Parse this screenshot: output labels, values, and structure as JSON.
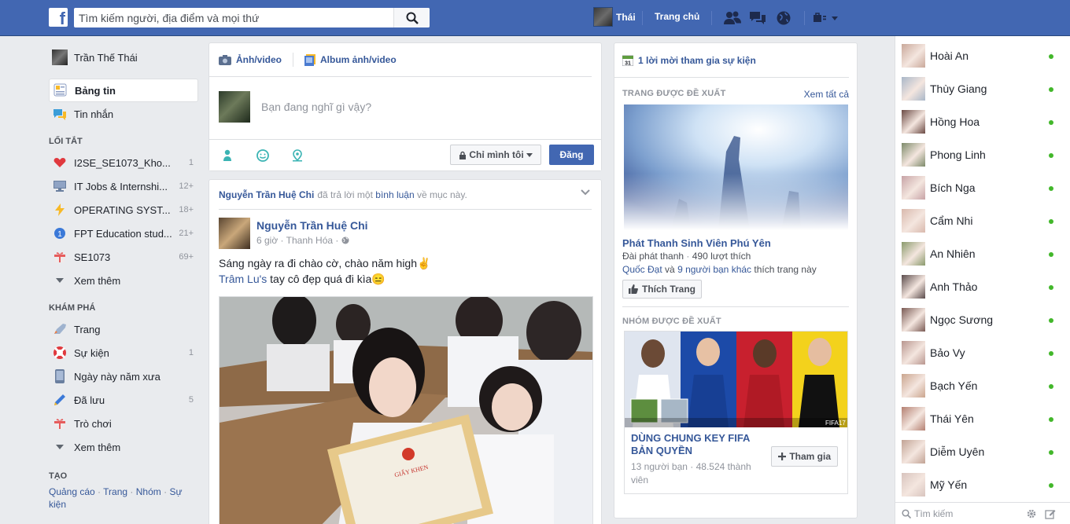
{
  "topbar": {
    "logo": "f",
    "search_placeholder": "Tìm kiếm người, địa điểm và mọi thứ",
    "profile_name": "Thái",
    "home_label": "Trang chủ"
  },
  "left": {
    "profile_name": "Trần Thế Thái",
    "nav": [
      {
        "label": "Bảng tin",
        "icon": "newsfeed-icon"
      },
      {
        "label": "Tin nhắn",
        "icon": "messages-icon"
      }
    ],
    "shortcuts_title": "LỐI TẮT",
    "shortcuts": [
      {
        "label": "I2SE_SE1073_Kho...",
        "count": "1",
        "icon": "heart-icon"
      },
      {
        "label": "IT Jobs & Internshi...",
        "count": "12+",
        "icon": "monitor-icon"
      },
      {
        "label": "OPERATING SYST...",
        "count": "18+",
        "icon": "lightning-icon"
      },
      {
        "label": "FPT Education stud...",
        "count": "21+",
        "icon": "badge-icon"
      },
      {
        "label": "SE1073",
        "count": "69+",
        "icon": "gift-icon"
      }
    ],
    "see_more_1": "Xem thêm",
    "explore_title": "KHÁM PHÁ",
    "explore": [
      {
        "label": "Trang",
        "count": "",
        "icon": "rocket-icon"
      },
      {
        "label": "Sự kiện",
        "count": "1",
        "icon": "lifebuoy-icon"
      },
      {
        "label": "Ngày này năm xưa",
        "count": "",
        "icon": "phone-icon"
      },
      {
        "label": "Đã lưu",
        "count": "5",
        "icon": "pencil-icon"
      },
      {
        "label": "Trò chơi",
        "count": "",
        "icon": "gift-icon"
      }
    ],
    "see_more_2": "Xem thêm",
    "create_title": "TẠO",
    "create_links": [
      "Quảng cáo",
      "Trang",
      "Nhóm",
      "Sự kiện"
    ]
  },
  "composer": {
    "tab_photo": "Ảnh/video",
    "tab_album": "Album ảnh/video",
    "placeholder": "Bạn đang nghĩ gì vậy?",
    "privacy": "Chỉ mình tôi",
    "post": "Đăng"
  },
  "story": {
    "header_name": "Nguyễn Trần Huệ Chi",
    "header_text1": "đã trả lời một",
    "header_link": "bình luận",
    "header_text2": "về mục này.",
    "author": "Nguyễn Trần Huệ Chi",
    "time": "6 giờ",
    "place": "Thanh Hóa",
    "line1": "Sáng ngày ra đi chào cờ, chào năm high✌",
    "mention": "Trâm Lu's",
    "line2": "tay cô đẹp quá đi kìa😑"
  },
  "right": {
    "event_invite": "1 lời mời tham gia sự kiện",
    "pages_title": "TRANG ĐƯỢC ĐỀ XUẤT",
    "see_all": "Xem tất cả",
    "page_name": "Phát Thanh Sinh Viên Phú Yên",
    "page_category": "Đài phát thanh",
    "page_likes": "490 lượt thích",
    "friend1": "Quốc Đạt",
    "friends_and": "và",
    "friends_others": "9 người bạn khác",
    "friends_like": "thích trang này",
    "like_btn": "Thích Trang",
    "groups_title": "NHÓM ĐƯỢC ĐỀ XUẤT",
    "group_name": "DÙNG CHUNG KEY FIFA BẢN QUYỀN",
    "group_friends": "13 người bạn",
    "group_members": "48.524",
    "group_members_label": "thành viên",
    "join_btn": "Tham gia",
    "fifa_label": "FIFA17"
  },
  "chat": {
    "contacts": [
      {
        "name": "Hoài An",
        "color": "#c9a89a"
      },
      {
        "name": "Thùy Giang",
        "color": "#a9b7c8"
      },
      {
        "name": "Hồng Hoa",
        "color": "#6b4a44"
      },
      {
        "name": "Phong Linh",
        "color": "#7d8a6a"
      },
      {
        "name": "Bích Nga",
        "color": "#c7a3a6"
      },
      {
        "name": "Cẩm Nhi",
        "color": "#d9b9ad"
      },
      {
        "name": "An Nhiên",
        "color": "#8a9a6c"
      },
      {
        "name": "Anh Thảo",
        "color": "#5a4b4b"
      },
      {
        "name": "Ngọc Sương",
        "color": "#7a5a54"
      },
      {
        "name": "Bảo Vy",
        "color": "#b9968f"
      },
      {
        "name": "Bạch Yến",
        "color": "#caa58e"
      },
      {
        "name": "Thái Yên",
        "color": "#b48072"
      },
      {
        "name": "Diễm Uyên",
        "color": "#c2a395"
      },
      {
        "name": "Mỹ Yến",
        "color": "#d8c4be"
      }
    ],
    "search_placeholder": "Tìm kiếm"
  }
}
